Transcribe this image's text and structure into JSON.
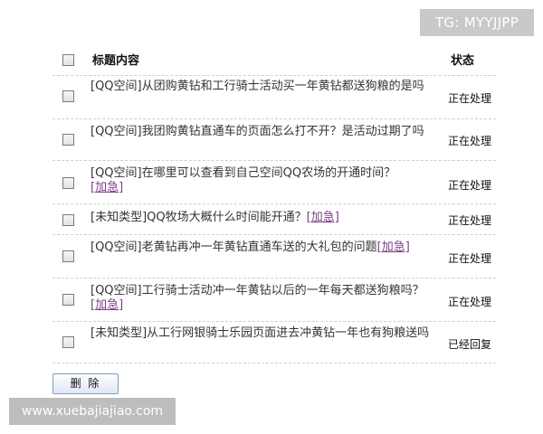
{
  "watermarks": {
    "top_right": "TG: MYYJJPP",
    "bottom_left": "www.xuebajiajiao.com"
  },
  "table": {
    "header": {
      "title": "标题内容",
      "status": "状态"
    },
    "rows": [
      {
        "category": "[QQ空间]",
        "title": "从团购黄钻和工行骑士活动买一年黄钻都送狗粮的是吗",
        "urgent": "",
        "status": "正在处理"
      },
      {
        "category": "[QQ空间]",
        "title": "我团购黄钻直通车的页面怎么打不开？是活动过期了吗",
        "urgent": "",
        "status": "正在处理"
      },
      {
        "category": "[QQ空间]",
        "title": "在哪里可以查看到自己空间QQ农场的开通时间？",
        "urgent": "[加急]",
        "status": "正在处理"
      },
      {
        "category": "[未知类型]",
        "title": "QQ牧场大概什么时间能开通？",
        "urgent": "[加急]",
        "status": "正在处理"
      },
      {
        "category": "[QQ空间]",
        "title": "老黄钻再冲一年黄钻直通车送的大礼包的问题",
        "urgent": "[加急]",
        "status": "正在处理"
      },
      {
        "category": "[QQ空间]",
        "title": "工行骑士活动冲一年黄钻以后的一年每天都送狗粮吗？",
        "urgent": "[加急]",
        "status": "正在处理"
      },
      {
        "category": "[未知类型]",
        "title": "从工行网银骑士乐园页面进去冲黄钻一年也有狗粮送吗",
        "urgent": "",
        "status": "已经回复"
      }
    ]
  },
  "actions": {
    "delete_label": "删 除"
  }
}
